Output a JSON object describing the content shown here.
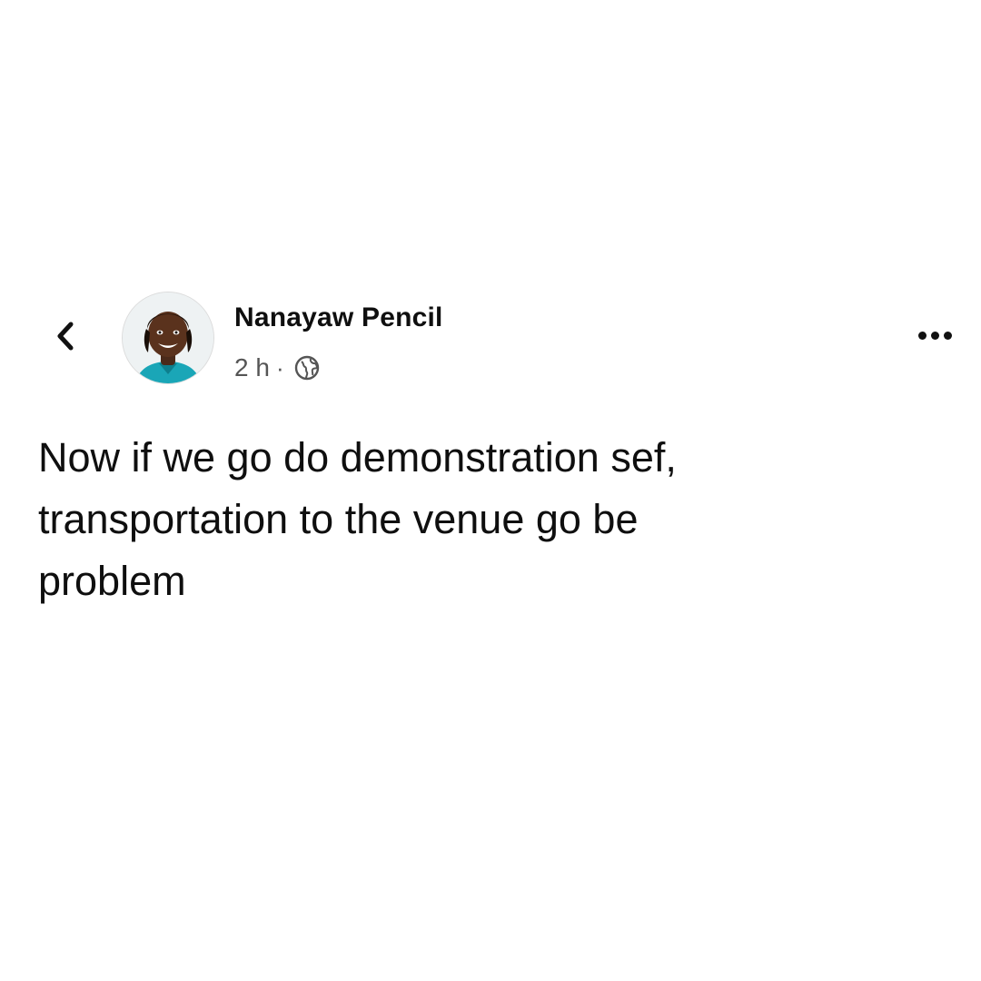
{
  "post": {
    "author": "Nanayaw Pencil",
    "time": "2 h",
    "separator": "·",
    "privacy_icon": "globe-icon",
    "text_lines": [
      "Now if we go do demonstration sef,",
      "transportation to the venue go be",
      "problem"
    ]
  },
  "icons": {
    "back": "chevron-left-icon",
    "more": "more-horizontal-icon"
  },
  "colors": {
    "background": "#ffffff",
    "text": "#0f0f0f",
    "meta": "#555555",
    "avatar_shirt": "#1aa6b7"
  }
}
